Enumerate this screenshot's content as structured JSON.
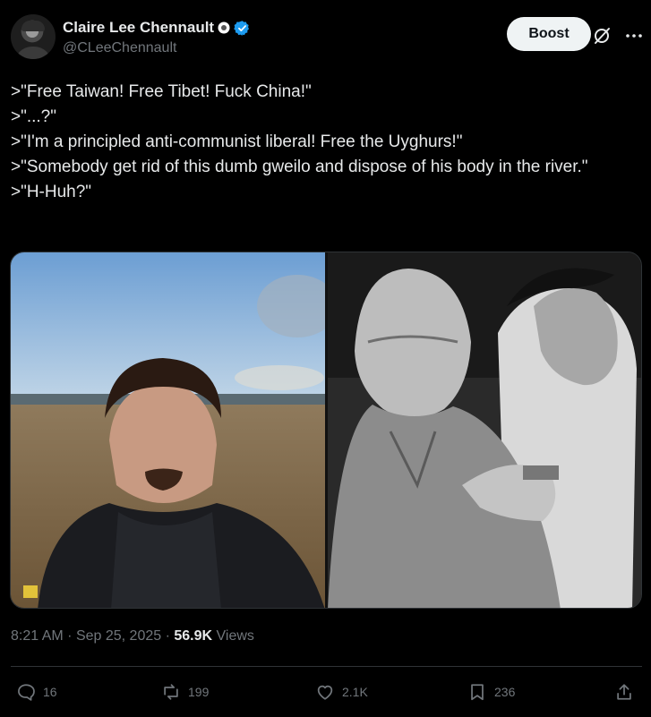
{
  "author": {
    "display_name": "Claire Lee Chennault",
    "handle": "@CLeeChennault"
  },
  "header": {
    "boost_label": "Boost"
  },
  "post": {
    "lines": [
      ">\"Free Taiwan! Free Tibet! Fuck China!\"",
      ">\"...?\"",
      ">\"I'm a principled anti-communist liberal! Free the Uyghurs!\"",
      ">\"Somebody get rid of this dumb gweilo and dispose of his body in the river.\"",
      ">\"H-Huh?\""
    ]
  },
  "meta": {
    "time": "8:21 AM",
    "date": "Sep 25, 2025",
    "views_count": "56.9K",
    "views_label": "Views",
    "separator": "·"
  },
  "actions": {
    "replies": "16",
    "reposts": "199",
    "likes": "2.1K",
    "bookmarks": "236"
  },
  "colors": {
    "background": "#000000",
    "text": "#e7e9ea",
    "muted": "#71767b",
    "verified": "#1d9bf0",
    "divider": "#2f3336",
    "button_bg": "#eff3f4"
  }
}
